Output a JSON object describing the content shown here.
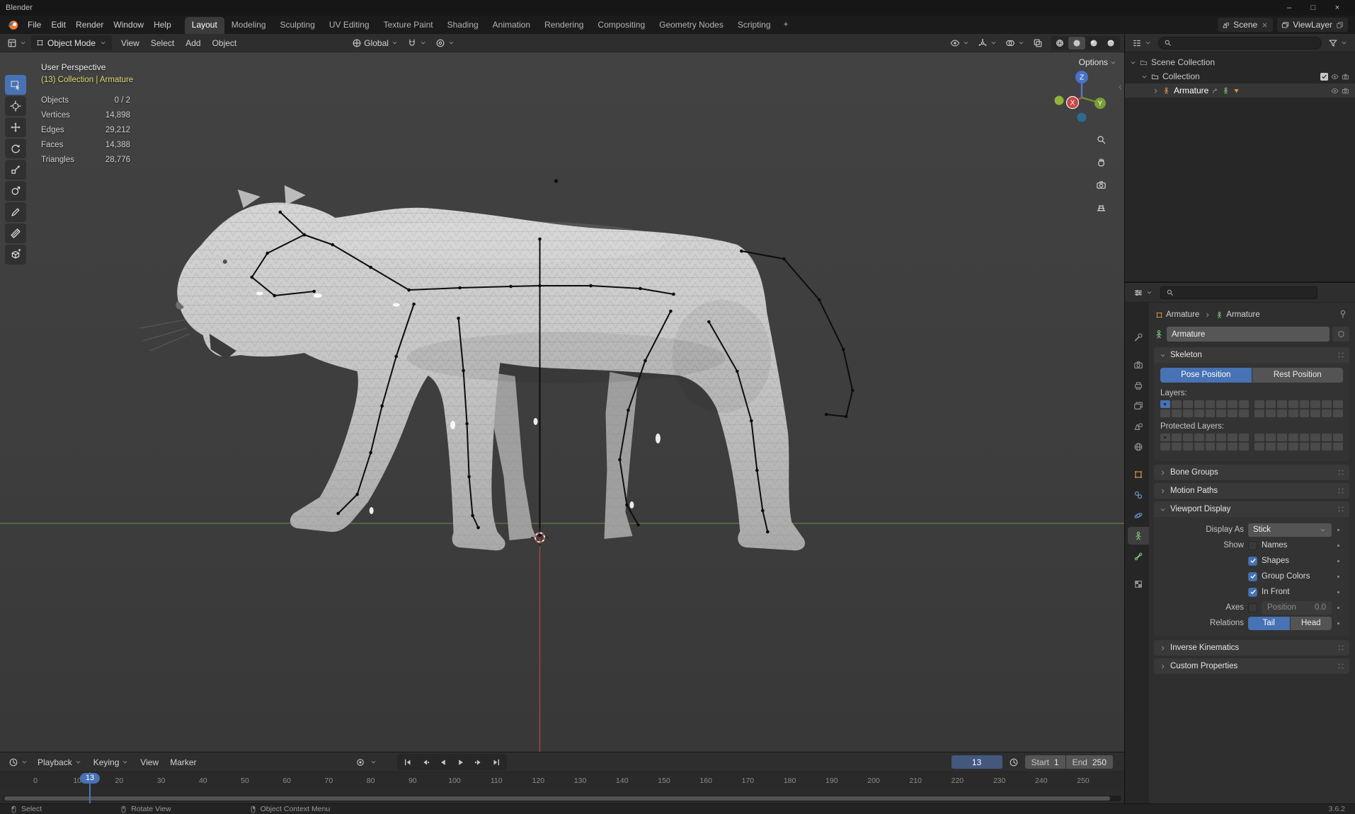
{
  "window": {
    "title": "Blender",
    "minimize_icon": "–",
    "maximize_icon": "□",
    "close_icon": "×"
  },
  "colors": {
    "accent": "#4772b3",
    "object_orange": "#de9a4a",
    "armature_green": "#79c879",
    "axis_x": "#c54747",
    "axis_y": "#7a9d33",
    "axis_z": "#4a72c8",
    "ground_line": "#5f8a3c",
    "axis_line_red": "#a84a42",
    "context_yellow": "#ddd870"
  },
  "menubar": {
    "menus": [
      "File",
      "Edit",
      "Render",
      "Window",
      "Help"
    ],
    "workspaces": [
      "Layout",
      "Modeling",
      "Sculpting",
      "UV Editing",
      "Texture Paint",
      "Shading",
      "Animation",
      "Rendering",
      "Compositing",
      "Geometry Nodes",
      "Scripting"
    ],
    "active_workspace": "Layout",
    "add_workspace_label": "+",
    "scene_label": "Scene",
    "view_layer_label": "ViewLayer"
  },
  "viewport_header": {
    "mode": "Object Mode",
    "menus": [
      "View",
      "Select",
      "Add",
      "Object"
    ],
    "orientation": "Global",
    "options_label": "Options"
  },
  "tools": [
    "select-box",
    "cursor",
    "move",
    "rotate",
    "scale",
    "transform",
    "annotate",
    "measure",
    "add-cube"
  ],
  "viewport": {
    "view_label": "User Perspective",
    "context_label": "(13) Collection | Armature",
    "stats": [
      {
        "label": "Objects",
        "value": "0 / 2"
      },
      {
        "label": "Vertices",
        "value": "14,898"
      },
      {
        "label": "Edges",
        "value": "29,212"
      },
      {
        "label": "Faces",
        "value": "14,388"
      },
      {
        "label": "Triangles",
        "value": "28,776"
      }
    ],
    "gizmo": {
      "x": "X",
      "y": "Y",
      "z": "Z"
    }
  },
  "outliner": {
    "search_placeholder": "",
    "rows": [
      {
        "label": "Scene Collection",
        "icon": "scene-collection",
        "indent": 0,
        "expanded": true,
        "selected": false,
        "badges": [],
        "trailing": []
      },
      {
        "label": "Collection",
        "icon": "collection",
        "indent": 1,
        "expanded": true,
        "selected": false,
        "badges": [],
        "trailing": [
          "checkbox",
          "eye",
          "camera"
        ]
      },
      {
        "label": "Armature",
        "icon": "armature",
        "indent": 2,
        "expanded": false,
        "selected": true,
        "badges": [
          "link",
          "pose",
          "triangle"
        ],
        "trailing": [
          "eye",
          "camera"
        ]
      }
    ]
  },
  "properties": {
    "tabs": [
      {
        "name": "tool"
      },
      {
        "name": "render"
      },
      {
        "name": "output"
      },
      {
        "name": "view-layer"
      },
      {
        "name": "scene"
      },
      {
        "name": "world"
      },
      {
        "name": "object"
      },
      {
        "name": "constraints"
      },
      {
        "name": "physics"
      },
      {
        "name": "object-data",
        "active": true
      },
      {
        "name": "bone"
      },
      {
        "name": "texture"
      }
    ],
    "breadcrumb": {
      "object": "Armature",
      "data": "Armature"
    },
    "name_field": {
      "value": "Armature"
    },
    "skeleton": {
      "title": "Skeleton",
      "pose_button": "Pose Position",
      "rest_button": "Rest Position",
      "active_button": "Pose Position",
      "layers_label": "Layers:",
      "protected_label": "Protected Layers:",
      "layers": {
        "active_cells": [
          0
        ],
        "dot_cells": [
          0
        ]
      },
      "protected": {
        "active_cells": [],
        "dot_cells": [
          0
        ]
      }
    },
    "collapsed_top": [
      "Bone Groups",
      "Motion Paths"
    ],
    "viewport_display": {
      "title": "Viewport Display",
      "display_as_label": "Display As",
      "display_as_value": "Stick",
      "show_label": "Show",
      "show_options": [
        {
          "label": "Names",
          "checked": false
        },
        {
          "label": "Shapes",
          "checked": true
        },
        {
          "label": "Group Colors",
          "checked": true
        },
        {
          "label": "In Front",
          "checked": true
        }
      ],
      "axes_label": "Axes",
      "axes_checked": false,
      "position_label": "Position",
      "position_value": "0.0",
      "relations_label": "Relations",
      "relations": [
        {
          "label": "Tail",
          "active": true
        },
        {
          "label": "Head",
          "active": false
        }
      ]
    },
    "collapsed_bottom": [
      "Inverse Kinematics",
      "Custom Properties"
    ]
  },
  "timeline": {
    "menus": [
      {
        "label": "Playback",
        "chevron": true
      },
      {
        "label": "Keying",
        "chevron": true
      },
      {
        "label": "View",
        "chevron": false
      },
      {
        "label": "Marker",
        "chevron": false
      }
    ],
    "current_frame": "13",
    "start_label": "Start",
    "start_value": "1",
    "end_label": "End",
    "end_value": "250",
    "ruler": {
      "min": 0,
      "max": 250,
      "step": 10,
      "playhead": 13
    }
  },
  "statusbar": {
    "hints": [
      {
        "mouse": "left",
        "label": "Select"
      },
      {
        "mouse": "middle",
        "label": "Rotate View"
      },
      {
        "mouse": "right",
        "label": "Object Context Menu"
      }
    ],
    "version": "3.6.2"
  }
}
